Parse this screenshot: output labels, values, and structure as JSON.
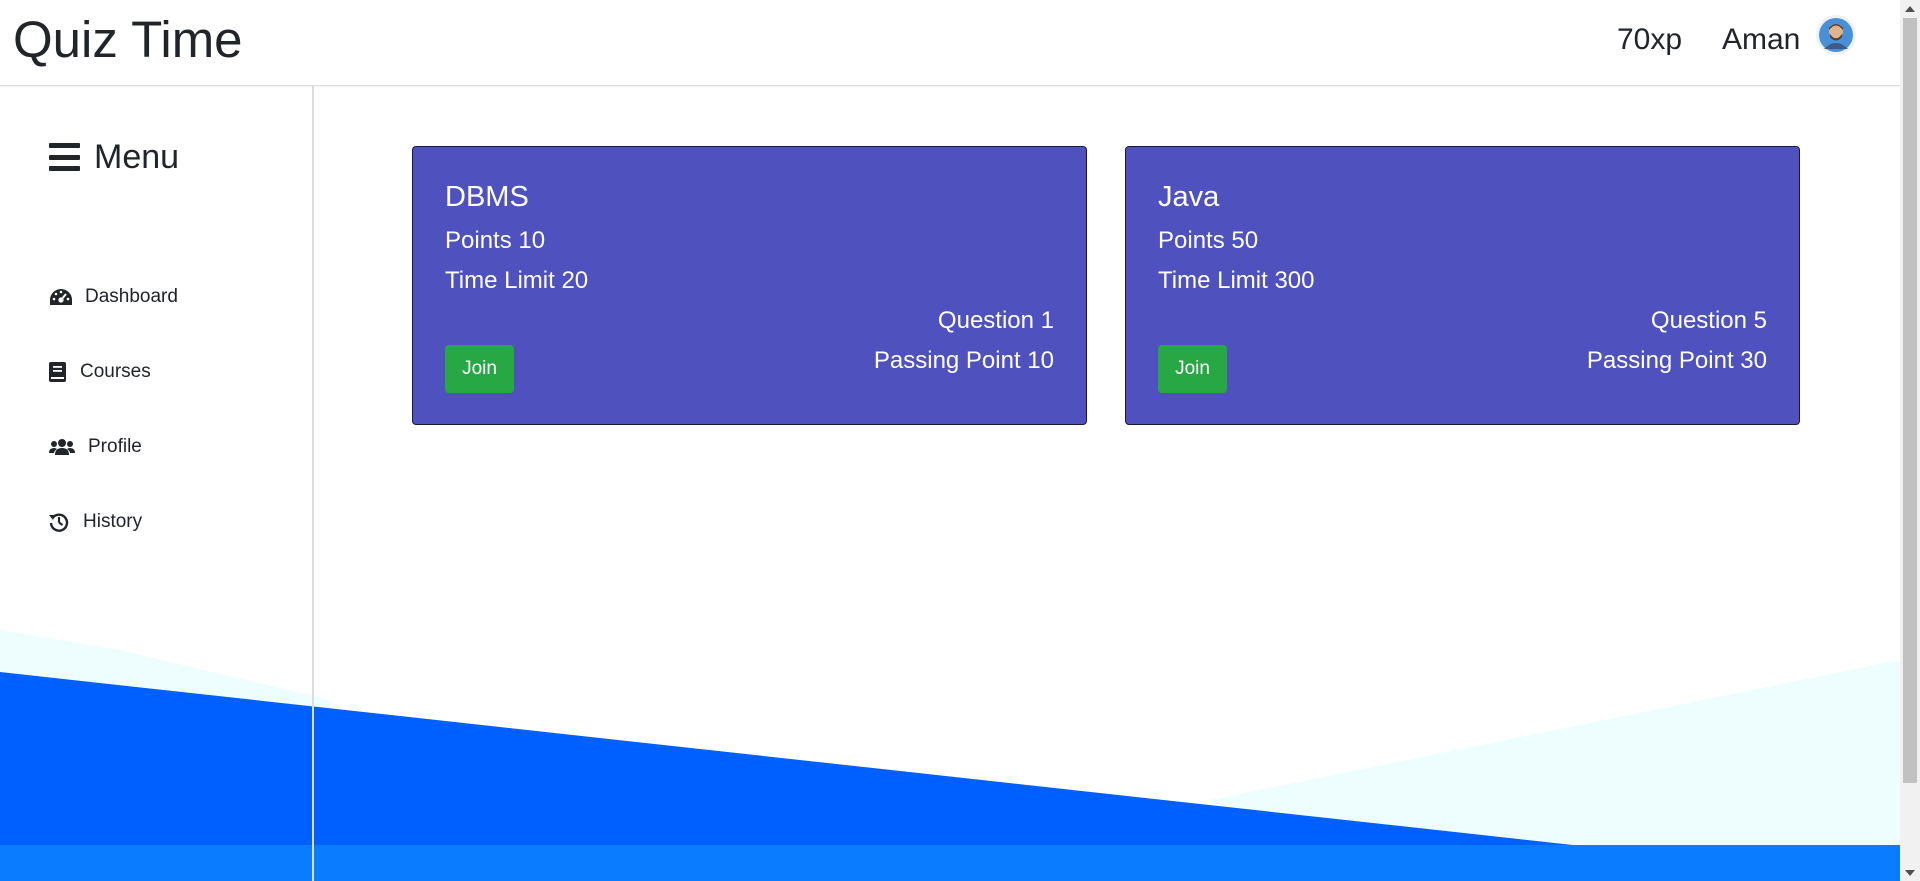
{
  "header": {
    "brand": "Quiz Time",
    "xp": "70xp",
    "username": "Aman",
    "avatar_icon": "user-avatar-icon"
  },
  "sidebar": {
    "menu_label": "Menu",
    "menu_icon": "hamburger-icon",
    "items": [
      {
        "label": "Dashboard",
        "icon": "dashboard-gauge-icon"
      },
      {
        "label": "Courses",
        "icon": "book-icon"
      },
      {
        "label": "Profile",
        "icon": "users-icon"
      },
      {
        "label": "History",
        "icon": "history-icon"
      }
    ]
  },
  "courses": [
    {
      "title": "DBMS",
      "points": "Points 10",
      "time_limit": "Time Limit 20",
      "question": "Question 1",
      "passing": "Passing Point 10",
      "join_label": "Join"
    },
    {
      "title": "Java",
      "points": "Points 50",
      "time_limit": "Time Limit 300",
      "question": "Question 5",
      "passing": "Passing Point 30",
      "join_label": "Join"
    }
  ],
  "colors": {
    "card_bg": "#4f52be",
    "join_button": "#28a745",
    "wave_blue": "#0060ff",
    "wave_light": "#eefeff",
    "footer_blue": "#0a7cff"
  }
}
